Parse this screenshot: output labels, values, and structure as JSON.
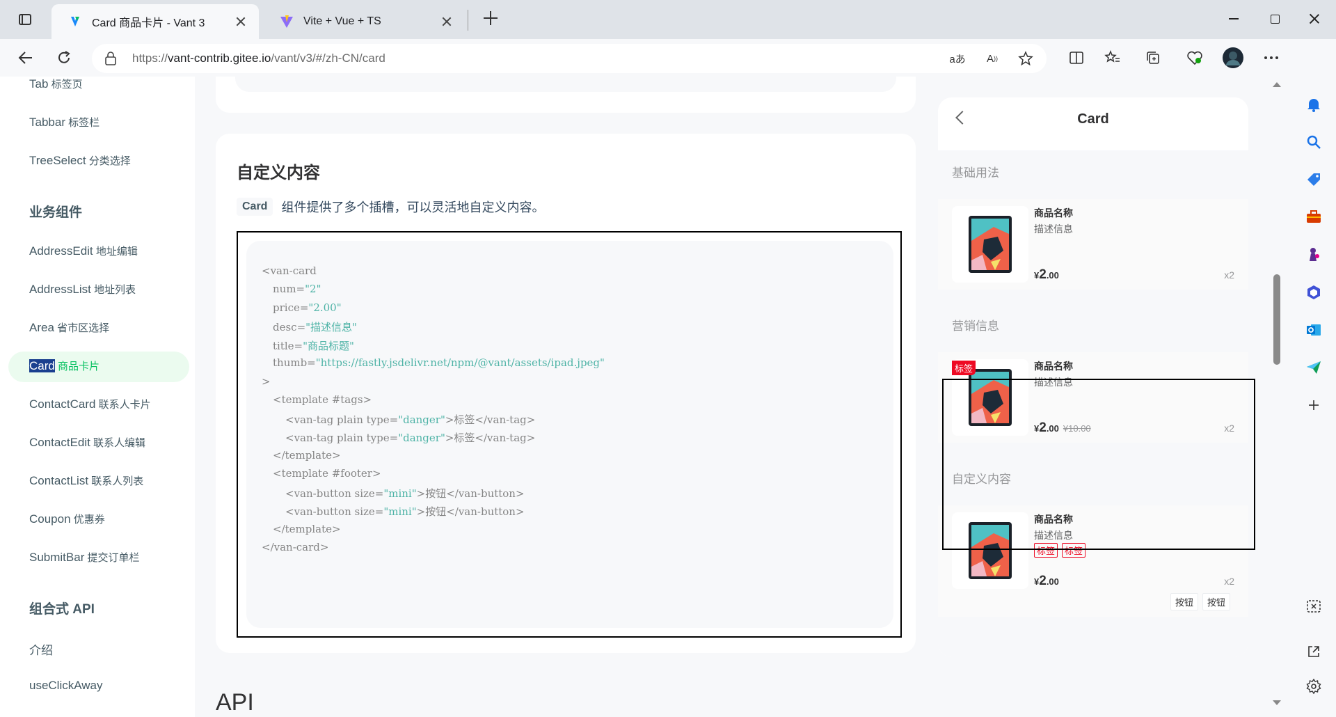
{
  "browser": {
    "tabs": [
      {
        "title": "Card 商品卡片 - Vant 3",
        "active": true
      },
      {
        "title": "Vite + Vue + TS",
        "active": false
      }
    ],
    "address": {
      "prefix": "https://",
      "host": "vant-contrib.gitee.io",
      "path": "/vant/v3/#/zh-CN/card"
    }
  },
  "sidebar": {
    "items": [
      {
        "en": "Tab",
        "zh": " 标签页"
      },
      {
        "en": "Tabbar",
        "zh": " 标签栏"
      },
      {
        "en": "TreeSelect",
        "zh": " 分类选择"
      },
      {
        "en": "AddressEdit",
        "zh": " 地址编辑"
      },
      {
        "en": "AddressList",
        "zh": " 地址列表"
      },
      {
        "en": "Area",
        "zh": " 省市区选择"
      },
      {
        "en": "Card",
        "zh": " 商品卡片"
      },
      {
        "en": "ContactCard",
        "zh": " 联系人卡片"
      },
      {
        "en": "ContactEdit",
        "zh": " 联系人编辑"
      },
      {
        "en": "ContactList",
        "zh": " 联系人列表"
      },
      {
        "en": "Coupon",
        "zh": " 优惠券"
      },
      {
        "en": "SubmitBar",
        "zh": " 提交订单栏"
      },
      {
        "en": "介绍",
        "zh": ""
      },
      {
        "en": "useClickAway",
        "zh": ""
      }
    ],
    "groups": [
      "业务组件",
      "组合式 API"
    ],
    "active_index": 6
  },
  "doc": {
    "heading": "自定义内容",
    "intro_code": "Card",
    "intro_text": "组件提供了多个插槽，可以灵活地自定义内容。",
    "code": {
      "l1": "<van-card",
      "l2_attr": "num=",
      "l2_val": "\"2\"",
      "l3_attr": "price=",
      "l3_val": "\"2.00\"",
      "l4_attr": "desc=",
      "l4_val": "\"描述信息\"",
      "l5_attr": "title=",
      "l5_val": "\"商品标题\"",
      "l6_attr": "thumb=",
      "l6_val": "\"https://fastly.jsdelivr.net/npm/@vant/assets/ipad.jpeg\"",
      "l7": ">",
      "l8": "<template #tags>",
      "l9_open": "<van-tag plain type=",
      "l9_val": "\"danger\"",
      "l9_text": ">标签</van-tag>",
      "l10_open": "<van-tag plain type=",
      "l10_val": "\"danger\"",
      "l10_text": ">标签</van-tag>",
      "l11": "</template>",
      "l12": "<template #footer>",
      "l13_open": "<van-button size=",
      "l13_val": "\"mini\"",
      "l13_text": ">按钮</van-button>",
      "l14_open": "<van-button size=",
      "l14_val": "\"mini\"",
      "l14_text": ">按钮</van-button>",
      "l15": "</template>",
      "l16": "</van-card>"
    },
    "api_heading": "API"
  },
  "phone": {
    "title": "Card",
    "sections": [
      {
        "title": "基础用法",
        "name": "商品名称",
        "desc": "描述信息",
        "currency": "¥",
        "price_int": "2",
        "price_dec": ".00",
        "num": "x2"
      },
      {
        "title": "营销信息",
        "name": "商品名称",
        "desc": "描述信息",
        "currency": "¥",
        "price_int": "2",
        "price_dec": ".00",
        "origin": "¥10.00",
        "num": "x2",
        "badge": "标签"
      },
      {
        "title": "自定义内容",
        "name": "商品名称",
        "desc": "描述信息",
        "currency": "¥",
        "price_int": "2",
        "price_dec": ".00",
        "num": "x2",
        "tags": [
          "标签",
          "标签"
        ],
        "buttons": [
          "按钮",
          "按钮"
        ]
      }
    ]
  },
  "colors": {
    "accent": "#07c160",
    "danger": "#ee0a24",
    "active_bg": "#ebfbef"
  }
}
